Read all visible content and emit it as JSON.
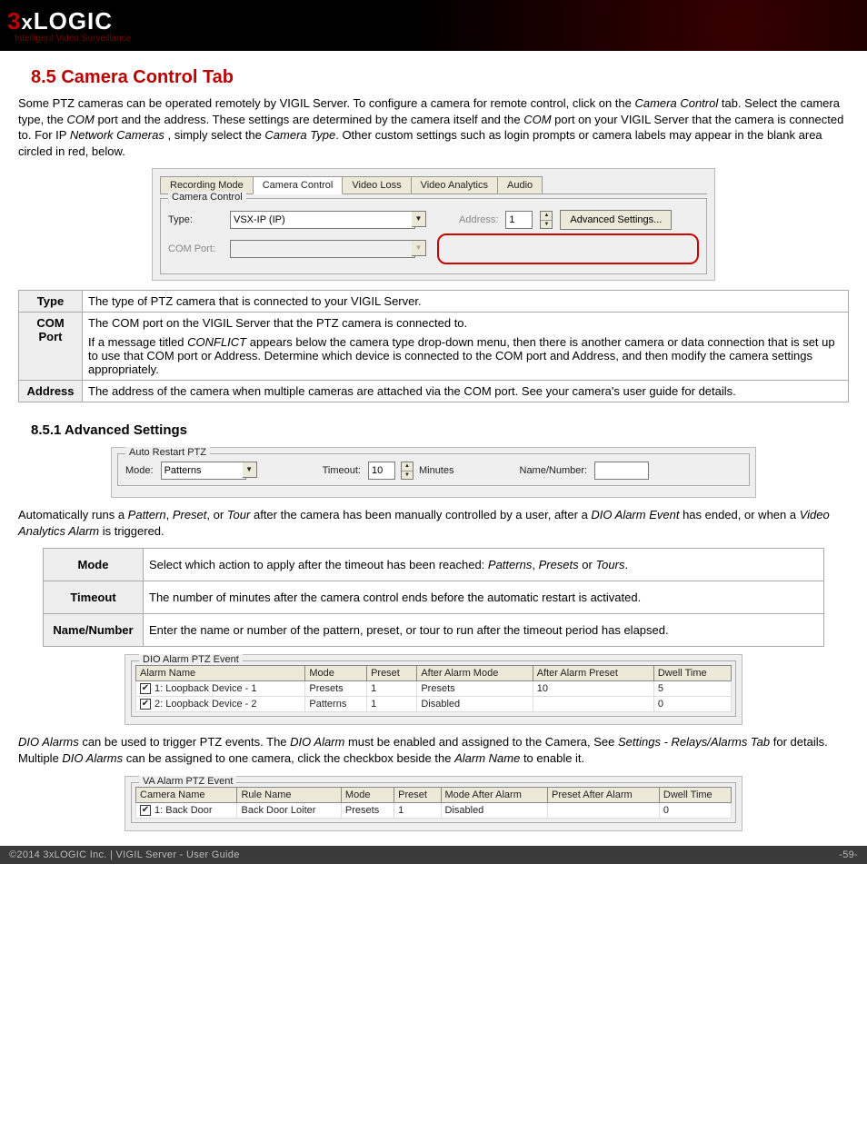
{
  "header": {
    "logo_three": "3",
    "logo_x": "x",
    "logo_logic": "LOGIC",
    "logo_sub": "Intelligent Video Surveillance"
  },
  "section": {
    "title": "8.5 Camera Control Tab",
    "intro_1": "Some PTZ cameras can be operated remotely by VIGIL Server. To configure a camera for remote control, click on the ",
    "intro_it1": "Camera Control",
    "intro_2": " tab. Select the camera type, the ",
    "intro_it2": "COM",
    "intro_3": " port and the address. These settings are determined by the camera itself and the ",
    "intro_it3": "COM",
    "intro_4": " port on your VIGIL Server that the camera is connected to.  For IP ",
    "intro_it4": "Network Cameras",
    "intro_5": " , simply select the ",
    "intro_it5": "Camera Type",
    "intro_6": ". Other custom settings such as login prompts or camera labels may appear in the blank area circled in red, below."
  },
  "panel1": {
    "tabs": [
      "Recording Mode",
      "Camera Control",
      "Video Loss",
      "Video Analytics",
      "Audio"
    ],
    "active_tab_index": 1,
    "group_label": "Camera Control",
    "type_label": "Type:",
    "type_value": "VSX-IP (IP)",
    "comport_label": "COM Port:",
    "address_label": "Address:",
    "address_value": "1",
    "adv_button": "Advanced Settings..."
  },
  "def_table1": {
    "rows": [
      {
        "k": "Type",
        "v": "The type of PTZ camera that is connected to your VIGIL Server."
      },
      {
        "k": "COM Port",
        "v_pre": "The COM port on the VIGIL Server that the PTZ camera is connected to.",
        "v_p2a": "If a message titled ",
        "v_p2it": "CONFLICT",
        "v_p2b": " appears below the camera type drop-down menu, then there is another camera or data connection that is set up to use that COM port or Address. Determine which device is connected to the COM port and Address, and then modify the camera settings appropriately."
      },
      {
        "k": "Address",
        "v": "The address of the camera when multiple cameras are attached via the COM port. See your camera's user guide for details."
      }
    ]
  },
  "subsection": {
    "title": "8.5.1 Advanced Settings"
  },
  "panel2": {
    "group_label": "Auto Restart PTZ",
    "mode_label": "Mode:",
    "mode_value": "Patterns",
    "timeout_label": "Timeout:",
    "timeout_value": "10",
    "timeout_unit": "Minutes",
    "namenum_label": "Name/Number:",
    "namenum_value": ""
  },
  "para_auto": {
    "a": "Automatically runs a ",
    "it1": "Pattern",
    "b": ", ",
    "it2": "Preset",
    "c": ", or ",
    "it3": "Tour",
    "d": " after the camera has been manually controlled by a user, after a ",
    "it4": "DIO Alarm Event",
    "e": " has ended, or when a ",
    "it5": "Video Analytics Alarm",
    "f": " is triggered."
  },
  "def_table2": {
    "rows": [
      {
        "k": "Mode",
        "v_a": "Select which action to apply after the timeout has been reached: ",
        "v_it1": "Patterns",
        "v_b": ", ",
        "v_it2": "Presets",
        "v_c": " or ",
        "v_it3": "Tours",
        "v_d": "."
      },
      {
        "k": "Timeout",
        "v": "The number of minutes after the camera control ends before the automatic restart is activated."
      },
      {
        "k": "Name/Number",
        "v": "Enter the name or number of the pattern, preset, or tour to run after the timeout period has elapsed."
      }
    ]
  },
  "panel3": {
    "group_label": "DIO Alarm PTZ Event",
    "headers": [
      "Alarm Name",
      "Mode",
      "Preset",
      "After Alarm Mode",
      "After Alarm Preset",
      "Dwell Time"
    ],
    "rows": [
      {
        "chk": true,
        "cells": [
          "1: Loopback Device - 1",
          "Presets",
          "1",
          "Presets",
          "10",
          "5"
        ]
      },
      {
        "chk": true,
        "cells": [
          "2: Loopback Device - 2",
          "Patterns",
          "1",
          "Disabled",
          "",
          "0"
        ]
      }
    ]
  },
  "para_dio": {
    "it1": "DIO Alarms",
    "a": " can be used to trigger PTZ events.  The ",
    "it2": "DIO Alarm",
    "b": " must be enabled and assigned to the Camera, See ",
    "it3": "Settings - Relays/Alarms Tab",
    "c": " for details.  Multiple ",
    "it4": "DIO Alarms",
    "d": " can be assigned to one camera, click the checkbox beside the ",
    "it5": "Alarm Name",
    "e": " to enable it."
  },
  "panel4": {
    "group_label": "VA Alarm PTZ Event",
    "headers": [
      "Camera Name",
      "Rule Name",
      "Mode",
      "Preset",
      "Mode After Alarm",
      "Preset After Alarm",
      "Dwell Time"
    ],
    "rows": [
      {
        "chk": true,
        "cells": [
          "1: Back Door",
          "Back Door Loiter",
          "Presets",
          "1",
          "Disabled",
          "",
          "0"
        ]
      }
    ]
  },
  "footer": {
    "left": "©2014 3xLOGIC Inc.  |  VIGIL Server - User Guide",
    "right": "-59-"
  }
}
